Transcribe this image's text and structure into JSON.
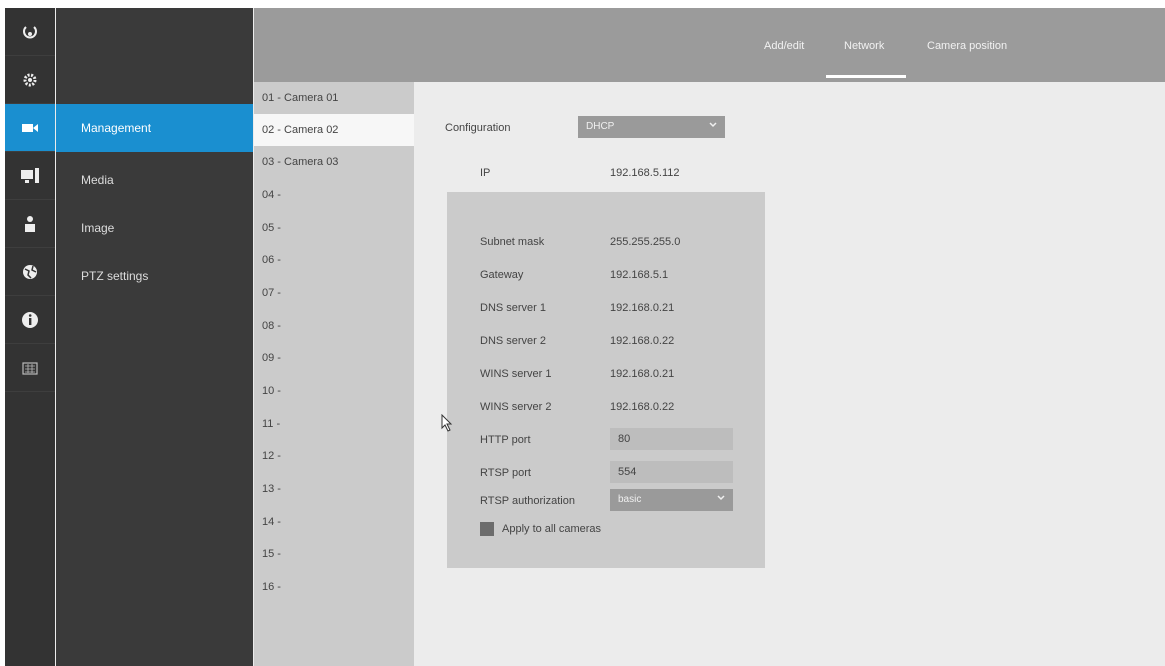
{
  "rail": {
    "icons": [
      "refresh-icon",
      "settings-gear-icon",
      "camera-icon",
      "monitor-icon",
      "user-icon",
      "globe-icon",
      "info-icon",
      "keyboard-icon"
    ]
  },
  "menu": {
    "items": [
      {
        "label": "Management",
        "active": true
      },
      {
        "label": "Media",
        "active": false
      },
      {
        "label": "Image",
        "active": false
      },
      {
        "label": "PTZ settings",
        "active": false
      }
    ]
  },
  "header": {
    "tabs": [
      {
        "label": "Add/edit"
      },
      {
        "label": "Network",
        "active": true
      },
      {
        "label": "Camera position"
      }
    ]
  },
  "cameras": [
    "01 - Camera 01",
    "02 - Camera 02",
    "03 - Camera 03",
    "04 -",
    "05 -",
    "06 -",
    "07 -",
    "08 -",
    "09 -",
    "10 -",
    "11 -",
    "12 -",
    "13 -",
    "14 -",
    "15 -",
    "16 -"
  ],
  "selected_camera_index": 1,
  "network": {
    "configuration_label": "Configuration",
    "configuration_value": "DHCP",
    "ip_label": "IP",
    "ip_value": "192.168.5.112",
    "subnet_label": "Subnet mask",
    "subnet_value": "255.255.255.0",
    "gateway_label": "Gateway",
    "gateway_value": "192.168.5.1",
    "dns1_label": "DNS server 1",
    "dns1_value": "192.168.0.21",
    "dns2_label": "DNS server 2",
    "dns2_value": "192.168.0.22",
    "wins1_label": "WINS server 1",
    "wins1_value": "192.168.0.21",
    "wins2_label": "WINS server 2",
    "wins2_value": "192.168.0.22",
    "http_port_label": "HTTP port",
    "http_port_value": "80",
    "rtsp_port_label": "RTSP port",
    "rtsp_port_value": "554",
    "rtsp_auth_label": "RTSP authorization",
    "rtsp_auth_value": "basic",
    "apply_all_label": "Apply to all cameras"
  }
}
